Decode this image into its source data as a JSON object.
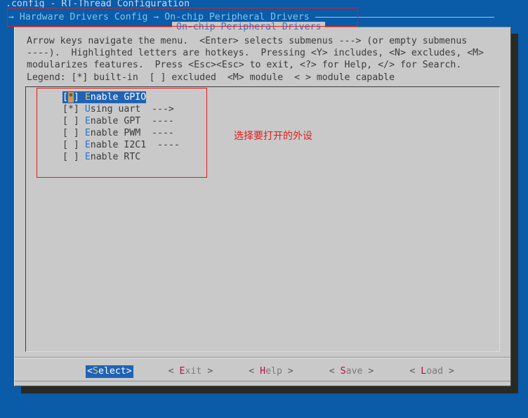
{
  "terminal": {
    "background_color": "#0a5ba8",
    "app_title": ".config - RT-Thread Configuration"
  },
  "breadcrumb": {
    "text": "→ Hardware Drivers Config → On-chip Peripheral Drivers"
  },
  "dialog": {
    "title": "On-chip Peripheral Drivers",
    "help_text": "Arrow keys navigate the menu.  <Enter> selects submenus ---> (or empty submenus\n----).  Highlighted letters are hotkeys.  Pressing <Y> includes, <N> excludes, <M>\nmodularizes features.  Press <Esc><Esc> to exit, <?> for Help, </> for Search.\nLegend: [*] built-in  [ ] excluded  <M> module  < > module capable"
  },
  "menu": {
    "items": [
      {
        "marker_open": "[",
        "marker_state": "*",
        "marker_close": "]",
        "hotkey": "E",
        "label_rest": "nable GPIO",
        "suffix": "",
        "selected": true
      },
      {
        "marker_open": "[",
        "marker_state": "*",
        "marker_close": "]",
        "hotkey": "U",
        "label_rest": "sing uart",
        "suffix": "  --->",
        "selected": false
      },
      {
        "marker_open": "[",
        "marker_state": " ",
        "marker_close": "]",
        "hotkey": "E",
        "label_rest": "nable GPT",
        "suffix": "  ----",
        "selected": false
      },
      {
        "marker_open": "[",
        "marker_state": " ",
        "marker_close": "]",
        "hotkey": "E",
        "label_rest": "nable PWM",
        "suffix": "  ----",
        "selected": false
      },
      {
        "marker_open": "[",
        "marker_state": " ",
        "marker_close": "]",
        "hotkey": "E",
        "label_rest": "nable I2C1",
        "suffix": "  ----",
        "selected": false
      },
      {
        "marker_open": "[",
        "marker_state": " ",
        "marker_close": "]",
        "hotkey": "E",
        "label_rest": "nable RTC",
        "suffix": "",
        "selected": false
      }
    ]
  },
  "buttons": [
    {
      "open": "<",
      "hotkey": "S",
      "rest": "elect",
      "close": ">",
      "active": true
    },
    {
      "open": "< ",
      "hotkey": "E",
      "rest": "xit",
      "close": " >",
      "active": false
    },
    {
      "open": "< ",
      "hotkey": "H",
      "rest": "elp",
      "close": " >",
      "active": false
    },
    {
      "open": "< ",
      "hotkey": "S",
      "rest": "ave",
      "close": " >",
      "active": false
    },
    {
      "open": "< ",
      "hotkey": "L",
      "rest": "oad",
      "close": " >",
      "active": false
    }
  ],
  "annotations": {
    "color": "#e41b1b",
    "note_text": "选择要打开的外设"
  }
}
